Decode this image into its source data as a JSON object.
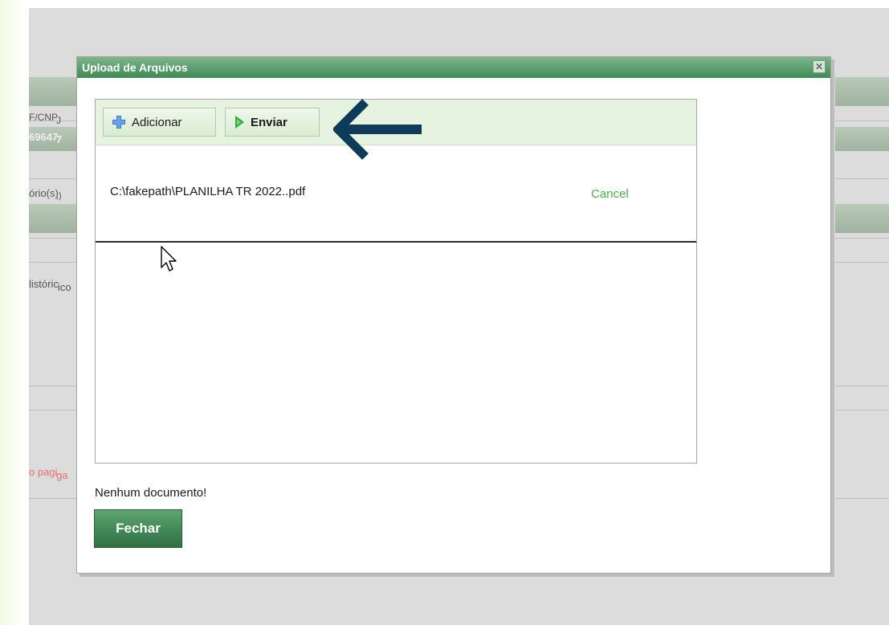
{
  "background": {
    "labels": [
      {
        "text": "F/CNP",
        "light": false
      },
      {
        "text": "J",
        "light": false
      },
      {
        "text": "69647",
        "light": true
      },
      {
        "text": "7",
        "light": true
      },
      {
        "text": "ório(s)",
        "light": false
      },
      {
        "text": ";)",
        "light": false
      },
      {
        "text": "listóric",
        "light": false
      },
      {
        "text": "ico",
        "light": false
      },
      {
        "text": "o pagi",
        "light": false
      },
      {
        "text": "ga",
        "light": false
      }
    ]
  },
  "dialog": {
    "title": "Upload de Arquivos",
    "close_symbol": "✕",
    "toolbar": {
      "add_label": "Adicionar",
      "send_label": "Enviar"
    },
    "file": {
      "name": "C:\\fakepath\\PLANILHA TR 2022..pdf",
      "cancel_label": "Cancel"
    },
    "status_text": "Nenhum documento!",
    "close_button_label": "Fechar"
  },
  "icons": {
    "add": "plus-icon",
    "send": "play-icon",
    "annotation": "arrow-left-icon",
    "pointer": "cursor-icon"
  },
  "colors": {
    "title_bar": "#3d8a55",
    "cancel_link": "#4caf50",
    "arrow": "#0e3b57"
  }
}
